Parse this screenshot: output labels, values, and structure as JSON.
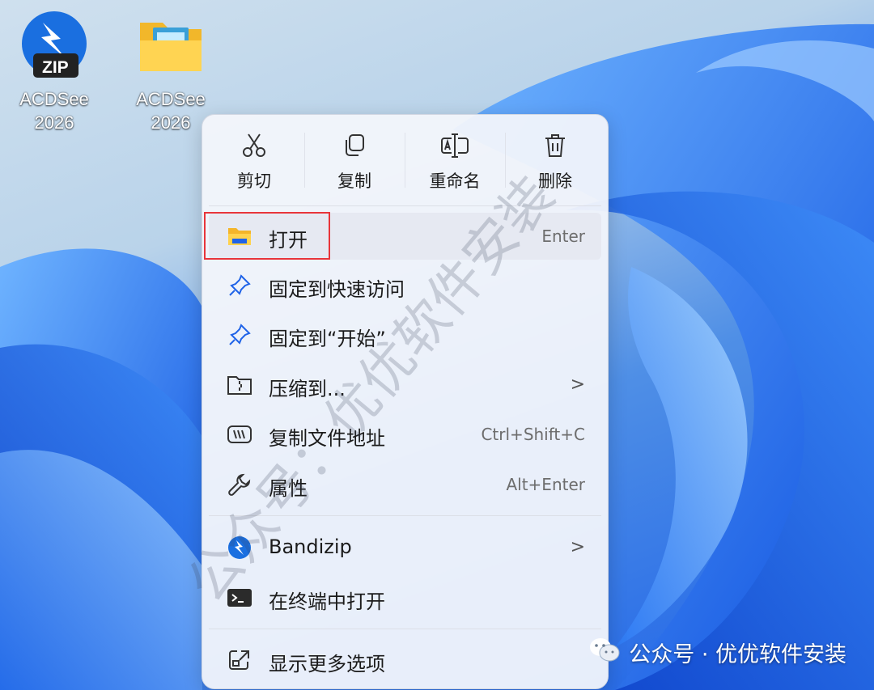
{
  "desktop_icons": [
    {
      "label_line1": "ACDSee",
      "label_line2": "2026",
      "icon": "zip-archive-icon",
      "badge": "ZIP"
    },
    {
      "label_line1": "ACDSee",
      "label_line2": "2026",
      "icon": "folder-icon"
    }
  ],
  "menu": {
    "toolbar": [
      {
        "label": "剪切",
        "icon": "scissors-icon"
      },
      {
        "label": "复制",
        "icon": "copy-icon"
      },
      {
        "label": "重命名",
        "icon": "rename-icon"
      },
      {
        "label": "删除",
        "icon": "trash-icon"
      }
    ],
    "items": [
      {
        "label": "打开",
        "shortcut": "Enter",
        "icon": "folder-open-icon"
      },
      {
        "label": "固定到快速访问",
        "icon": "pin-icon"
      },
      {
        "label": "固定到“开始”",
        "icon": "pin-icon"
      },
      {
        "label": "压缩到...",
        "icon": "zip-folder-icon",
        "submenu": ">"
      },
      {
        "label": "复制文件地址",
        "shortcut": "Ctrl+Shift+C",
        "icon": "path-icon"
      },
      {
        "label": "属性",
        "shortcut": "Alt+Enter",
        "icon": "wrench-icon"
      },
      {
        "label": "Bandizip",
        "icon": "bandizip-icon",
        "submenu": ">"
      },
      {
        "label": "在终端中打开",
        "icon": "terminal-icon"
      },
      {
        "label": "显示更多选项",
        "icon": "expand-icon"
      }
    ]
  },
  "watermark": "公众号：优优软件安装",
  "footer": {
    "text": "公众号 · 优优软件安装",
    "icon": "wechat-icon"
  },
  "colors": {
    "highlight_border": "#e8353a",
    "accent": "#1f63e8"
  }
}
